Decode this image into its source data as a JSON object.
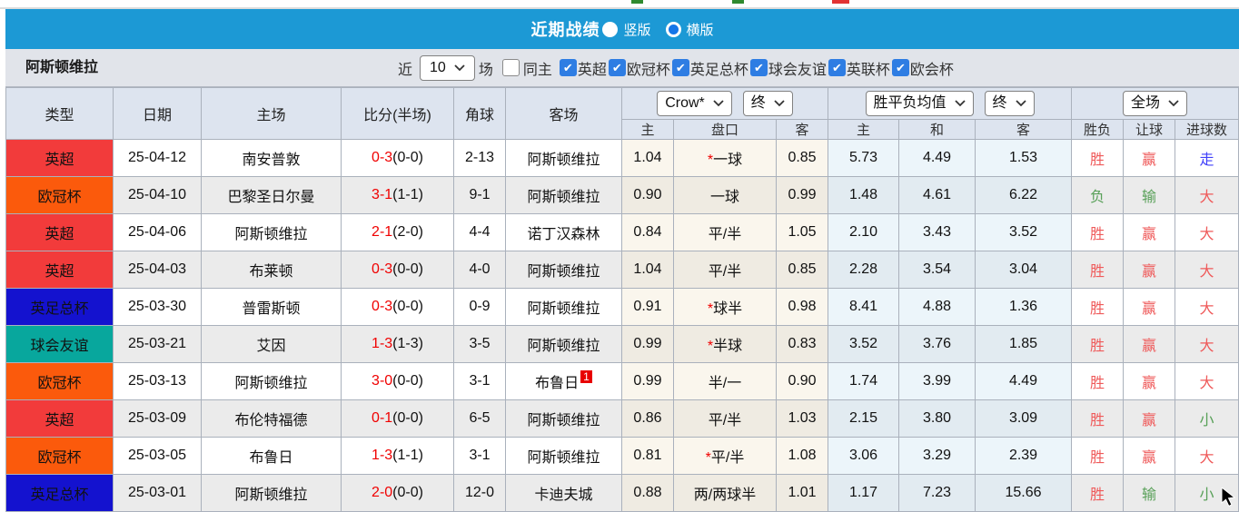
{
  "title_bar": {
    "title": "近期战绩",
    "option_vertical": "竖版",
    "option_horizontal": "横版"
  },
  "filter_bar": {
    "team": "阿斯顿维拉",
    "near_label": "近",
    "count_value": "10",
    "matches_label": "场",
    "same_home_label": "同主",
    "competitions": [
      "英超",
      "欧冠杯",
      "英足总杯",
      "球会友谊",
      "英联杯",
      "欧会杯"
    ]
  },
  "table": {
    "col_headers": {
      "type": "类型",
      "date": "日期",
      "home": "主场",
      "score": "比分(半场)",
      "corner": "角球",
      "away": "客场"
    },
    "dropdowns": {
      "odds_source": "Crow*",
      "odds_time": "终",
      "mean_source": "胜平负均值",
      "mean_time": "终",
      "scope": "全场"
    },
    "sub_headers": {
      "odds": [
        "主",
        "盘口",
        "客"
      ],
      "mean": [
        "主",
        "和",
        "客"
      ],
      "result": [
        "胜负",
        "让球",
        "进球数"
      ]
    },
    "type_colors": {
      "英超": "#f23b3b",
      "欧冠杯": "#fb5a0c",
      "英足总杯": "#1412cf",
      "球会友谊": "#08a79d"
    },
    "outcome_colors": {
      "red": "#ef5a5a",
      "green": "#58a058",
      "blue": "#4040fa"
    },
    "rows": [
      {
        "type": "英超",
        "date": "25-04-12",
        "home": {
          "name": "南安普敦",
          "highlight": false
        },
        "score": "0-3",
        "half": "(0-0)",
        "corner": "2-13",
        "away": {
          "name": "阿斯顿维拉",
          "highlight": true
        },
        "odds": [
          "1.04",
          "*一球",
          "0.85"
        ],
        "mean": [
          "5.73",
          "4.49",
          "1.53"
        ],
        "result": {
          "text": "胜",
          "c": "red"
        },
        "handicap": {
          "text": "赢",
          "c": "red"
        },
        "goals": {
          "text": "走",
          "c": "blue"
        }
      },
      {
        "type": "欧冠杯",
        "date": "25-04-10",
        "home": {
          "name": "巴黎圣日尔曼",
          "highlight": false
        },
        "score": "3-1",
        "half": "(1-1)",
        "corner": "9-1",
        "away": {
          "name": "阿斯顿维拉",
          "highlight": true
        },
        "odds": [
          "0.90",
          "一球",
          "0.99"
        ],
        "mean": [
          "1.48",
          "4.61",
          "6.22"
        ],
        "result": {
          "text": "负",
          "c": "green"
        },
        "handicap": {
          "text": "输",
          "c": "green"
        },
        "goals": {
          "text": "大",
          "c": "red"
        }
      },
      {
        "type": "英超",
        "date": "25-04-06",
        "home": {
          "name": "阿斯顿维拉",
          "highlight": true
        },
        "score": "2-1",
        "half": "(2-0)",
        "corner": "4-4",
        "away": {
          "name": "诺丁汉森林",
          "highlight": false
        },
        "odds": [
          "0.84",
          "平/半",
          "1.05"
        ],
        "mean": [
          "2.10",
          "3.43",
          "3.52"
        ],
        "result": {
          "text": "胜",
          "c": "red"
        },
        "handicap": {
          "text": "赢",
          "c": "red"
        },
        "goals": {
          "text": "大",
          "c": "red"
        }
      },
      {
        "type": "英超",
        "date": "25-04-03",
        "home": {
          "name": "布莱顿",
          "highlight": false
        },
        "score": "0-3",
        "half": "(0-0)",
        "corner": "4-0",
        "away": {
          "name": "阿斯顿维拉",
          "highlight": true
        },
        "odds": [
          "1.04",
          "平/半",
          "0.85"
        ],
        "mean": [
          "2.28",
          "3.54",
          "3.04"
        ],
        "result": {
          "text": "胜",
          "c": "red"
        },
        "handicap": {
          "text": "赢",
          "c": "red"
        },
        "goals": {
          "text": "大",
          "c": "red"
        }
      },
      {
        "type": "英足总杯",
        "date": "25-03-30",
        "home": {
          "name": "普雷斯顿",
          "highlight": false
        },
        "score": "0-3",
        "half": "(0-0)",
        "corner": "0-9",
        "away": {
          "name": "阿斯顿维拉",
          "highlight": true
        },
        "odds": [
          "0.91",
          "*球半",
          "0.98"
        ],
        "mean": [
          "8.41",
          "4.88",
          "1.36"
        ],
        "result": {
          "text": "胜",
          "c": "red"
        },
        "handicap": {
          "text": "赢",
          "c": "red"
        },
        "goals": {
          "text": "大",
          "c": "red"
        }
      },
      {
        "type": "球会友谊",
        "date": "25-03-21",
        "home": {
          "name": "艾因",
          "highlight": false
        },
        "score": "1-3",
        "half": "(1-3)",
        "corner": "3-5",
        "away": {
          "name": "阿斯顿维拉",
          "highlight": true
        },
        "odds": [
          "0.99",
          "*半球",
          "0.83"
        ],
        "mean": [
          "3.52",
          "3.76",
          "1.85"
        ],
        "result": {
          "text": "胜",
          "c": "red"
        },
        "handicap": {
          "text": "赢",
          "c": "red"
        },
        "goals": {
          "text": "大",
          "c": "red"
        }
      },
      {
        "type": "欧冠杯",
        "date": "25-03-13",
        "home": {
          "name": "阿斯顿维拉",
          "highlight": true
        },
        "score": "3-0",
        "half": "(0-0)",
        "corner": "3-1",
        "away": {
          "name": "布鲁日",
          "highlight": false,
          "badge": "1"
        },
        "odds": [
          "0.99",
          "半/一",
          "0.90"
        ],
        "mean": [
          "1.74",
          "3.99",
          "4.49"
        ],
        "result": {
          "text": "胜",
          "c": "red"
        },
        "handicap": {
          "text": "赢",
          "c": "red"
        },
        "goals": {
          "text": "大",
          "c": "red"
        }
      },
      {
        "type": "英超",
        "date": "25-03-09",
        "home": {
          "name": "布伦特福德",
          "highlight": false
        },
        "score": "0-1",
        "half": "(0-0)",
        "corner": "6-5",
        "away": {
          "name": "阿斯顿维拉",
          "highlight": true
        },
        "odds": [
          "0.86",
          "平/半",
          "1.03"
        ],
        "mean": [
          "2.15",
          "3.80",
          "3.09"
        ],
        "result": {
          "text": "胜",
          "c": "red"
        },
        "handicap": {
          "text": "赢",
          "c": "red"
        },
        "goals": {
          "text": "小",
          "c": "green"
        }
      },
      {
        "type": "欧冠杯",
        "date": "25-03-05",
        "home": {
          "name": "布鲁日",
          "highlight": false
        },
        "score": "1-3",
        "half": "(1-1)",
        "corner": "3-1",
        "away": {
          "name": "阿斯顿维拉",
          "highlight": true
        },
        "odds": [
          "0.81",
          "*平/半",
          "1.08"
        ],
        "mean": [
          "3.06",
          "3.29",
          "2.39"
        ],
        "result": {
          "text": "胜",
          "c": "red"
        },
        "handicap": {
          "text": "赢",
          "c": "red"
        },
        "goals": {
          "text": "大",
          "c": "red"
        }
      },
      {
        "type": "英足总杯",
        "date": "25-03-01",
        "home": {
          "name": "阿斯顿维拉",
          "highlight": true
        },
        "score": "2-0",
        "half": "(0-0)",
        "corner": "12-0",
        "away": {
          "name": "卡迪夫城",
          "highlight": false
        },
        "odds": [
          "0.88",
          "两/两球半",
          "1.01"
        ],
        "mean": [
          "1.17",
          "7.23",
          "15.66"
        ],
        "result": {
          "text": "胜",
          "c": "red"
        },
        "handicap": {
          "text": "输",
          "c": "green"
        },
        "goals": {
          "text": "小",
          "c": "green"
        }
      }
    ]
  }
}
